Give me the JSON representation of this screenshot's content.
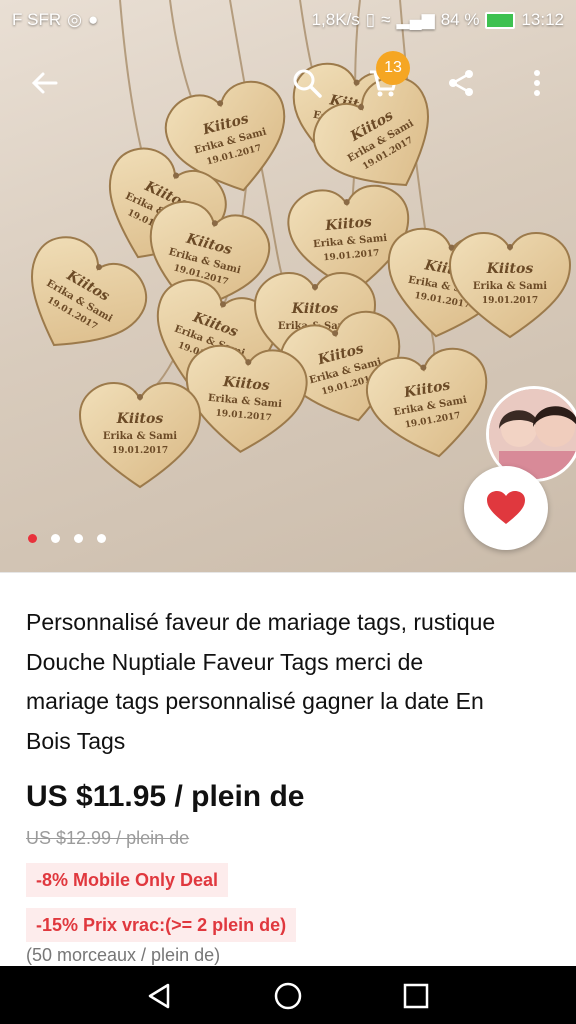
{
  "status_bar": {
    "carrier": "F SFR",
    "speed": "1,8K/s",
    "battery": "84 %",
    "time": "13:12"
  },
  "toolbar": {
    "cart_count": "13"
  },
  "gallery": {
    "image_count": 4,
    "active_index": 0,
    "tag_text": {
      "line1": "Kiitos",
      "line2": "Erika & Sami",
      "line3": "19.01.2017"
    }
  },
  "product": {
    "title_lines": [
      "Personnalisé faveur de mariage tags, rustique",
      "Douche Nuptiale Faveur Tags merci de",
      "mariage tags personnalisé gagner la date En",
      "Bois Tags"
    ],
    "price": "US $11.95 / plein de",
    "old_price": "US $12.99 / plein de",
    "deal_mobile": "-8%  Mobile Only Deal",
    "deal_bulk": "-15%  Prix vrac:(>= 2 plein de)",
    "unit_info": "(50 morceaux / plein de)"
  },
  "colors": {
    "accent_red": "#e8323c",
    "badge_orange": "#f5a623",
    "deal_background": "#fdecec",
    "deal_text": "#e0383e"
  },
  "icons": [
    "back-arrow-icon",
    "search-icon",
    "cart-icon",
    "share-icon",
    "more-icon",
    "heart-icon",
    "nav-back-icon",
    "nav-home-icon",
    "nav-recents-icon"
  ]
}
